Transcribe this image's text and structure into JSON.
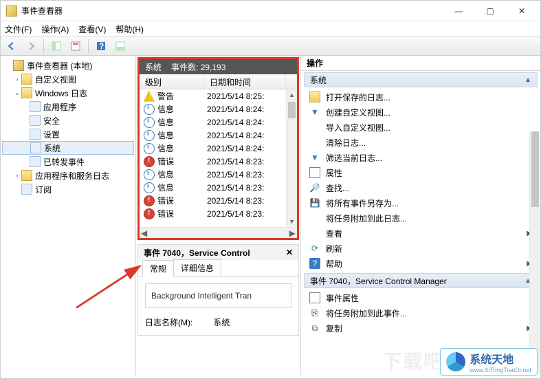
{
  "window": {
    "title": "事件查看器"
  },
  "menu": {
    "file": "文件(F)",
    "action": "操作(A)",
    "view": "查看(V)",
    "help": "帮助(H)"
  },
  "tree": {
    "root": "事件查看器 (本地)",
    "custom_views": "自定义视图",
    "windows_logs": "Windows 日志",
    "application": "应用程序",
    "security": "安全",
    "setup": "设置",
    "system": "系统",
    "forwarded": "已转发事件",
    "apps_services": "应用程序和服务日志",
    "subscriptions": "订阅"
  },
  "grid": {
    "header_section": "系统",
    "header_count_label": "事件数:",
    "header_count": "29,193",
    "col_level": "级别",
    "col_datetime": "日期和时间",
    "rows": [
      {
        "icon": "warn",
        "level": "警告",
        "dt": "2021/5/14 8:25:"
      },
      {
        "icon": "info",
        "level": "信息",
        "dt": "2021/5/14 8:24:"
      },
      {
        "icon": "info",
        "level": "信息",
        "dt": "2021/5/14 8:24:"
      },
      {
        "icon": "info",
        "level": "信息",
        "dt": "2021/5/14 8:24:"
      },
      {
        "icon": "info",
        "level": "信息",
        "dt": "2021/5/14 8:24:"
      },
      {
        "icon": "error",
        "level": "错误",
        "dt": "2021/5/14 8:23:"
      },
      {
        "icon": "info",
        "level": "信息",
        "dt": "2021/5/14 8:23:"
      },
      {
        "icon": "info",
        "level": "信息",
        "dt": "2021/5/14 8:23:"
      },
      {
        "icon": "error",
        "level": "错误",
        "dt": "2021/5/14 8:23:"
      },
      {
        "icon": "error",
        "level": "错误",
        "dt": "2021/5/14 8:23:"
      }
    ]
  },
  "detail": {
    "title": "事件 7040，Service Control",
    "tab_general": "常规",
    "tab_details": "详细信息",
    "body_text": "Background Intelligent Tran",
    "log_name_label": "日志名称(M):",
    "log_name_value": "系统"
  },
  "actions": {
    "pane_title": "操作",
    "group1": "系统",
    "open_saved": "打开保存的日志...",
    "create_view": "创建自定义视图...",
    "import_view": "导入自定义视图...",
    "clear_log": "清除日志...",
    "filter_log": "筛选当前日志...",
    "properties": "属性",
    "find": "查找...",
    "save_as": "将所有事件另存为...",
    "attach_task": "将任务附加到此日志...",
    "view": "查看",
    "refresh": "刷新",
    "help": "帮助",
    "group2": "事件 7040，Service Control Manager",
    "event_props": "事件属性",
    "attach_task_event": "将任务附加到此事件...",
    "copy": "复制"
  },
  "watermark": {
    "brand": "系统天地",
    "url": "www.XiTongTianDi.net",
    "dl": "下载吧"
  }
}
